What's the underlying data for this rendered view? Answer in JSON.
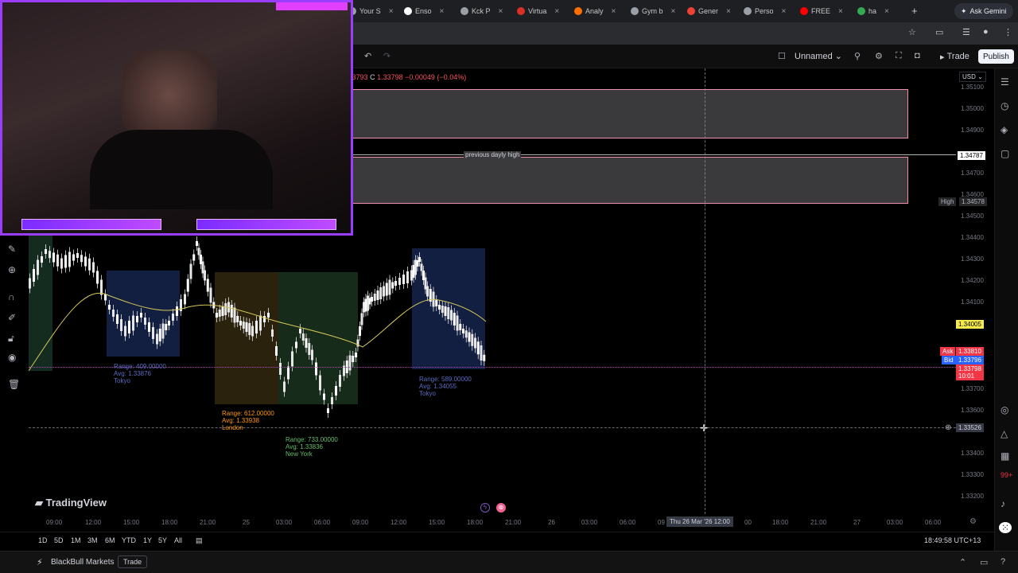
{
  "browser": {
    "tabs": [
      {
        "label": "Your S",
        "color": "#9aa0a6"
      },
      {
        "label": "Enso",
        "color": "#ffffff"
      },
      {
        "label": "Kck P",
        "color": "#9aa0a6"
      },
      {
        "label": "Virtua",
        "color": "#d93025"
      },
      {
        "label": "Analy",
        "color": "#ff6f00"
      },
      {
        "label": "Gym b",
        "color": "#9aa0a6"
      },
      {
        "label": "Gener",
        "color": "#ea4335"
      },
      {
        "label": "Perso",
        "color": "#9aa0a6"
      },
      {
        "label": "FREE",
        "color": "#ff0000"
      },
      {
        "label": "ha",
        "color": "#34a853"
      }
    ],
    "new_tab": "+",
    "gemini": "Ask Gemini"
  },
  "toolbar": {
    "unnamed": "Unnamed",
    "trade": "Trade",
    "publish": "Publish",
    "currency": "USD"
  },
  "ohlc": {
    "prefix": "1.33793",
    "close_label": "C",
    "close": "1.33798",
    "change": "−0.00049 (−0.04%)"
  },
  "annotations": {
    "previous_daily_high": "previous dayly high"
  },
  "price_axis": {
    "ticks": [
      "1.35100",
      "1.35000",
      "1.34900",
      "1.34700",
      "1.34600",
      "1.34500",
      "1.34400",
      "1.34300",
      "1.34200",
      "1.34100",
      "1.33700",
      "1.33600",
      "1.33400",
      "1.33300",
      "1.33200"
    ],
    "pdh_value": "1.34787",
    "high_label": "High",
    "high_value": "1.34578",
    "yellow_value": "1.34005",
    "ask_label": "Ask",
    "ask_value": "1.33810",
    "bid_label": "Bid",
    "bid_value": "1.33796",
    "last_value": "1.33798",
    "countdown": "10:01",
    "cross_value": "1.33526"
  },
  "sessions": [
    {
      "range": "Range: 409.00000",
      "avg": "Avg: 1.33876",
      "name": "Tokyo",
      "color": "#5c6bc0"
    },
    {
      "range": "Range: 612.00000",
      "avg": "Avg: 1.33938",
      "name": "London",
      "color": "#ff9800"
    },
    {
      "range": "Range: 733.00000",
      "avg": "Avg: 1.33836",
      "name": "New York",
      "color": "#66bb6a"
    },
    {
      "range": "Range: 589.00000",
      "avg": "Avg: 1.34055",
      "name": "Tokyo",
      "color": "#5c6bc0"
    }
  ],
  "logo": "TradingView",
  "time_axis": {
    "ticks": [
      "09:00",
      "12:00",
      "15:00",
      "18:00",
      "21:00",
      "25",
      "03:00",
      "06:00",
      "09:00",
      "12:00",
      "15:00",
      "18:00",
      "21:00",
      "26",
      "03:00",
      "06:00",
      "09",
      "00",
      "18:00",
      "21:00",
      "27",
      "03:00",
      "06:00"
    ],
    "cursor": "Thu 26 Mar '26  12:00"
  },
  "range_buttons": [
    "1D",
    "5D",
    "1M",
    "3M",
    "6M",
    "YTD",
    "1Y",
    "5Y",
    "All"
  ],
  "clock": "18:49:58 UTC+13",
  "bottom": {
    "broker": "BlackBull Markets",
    "trade": "Trade"
  }
}
